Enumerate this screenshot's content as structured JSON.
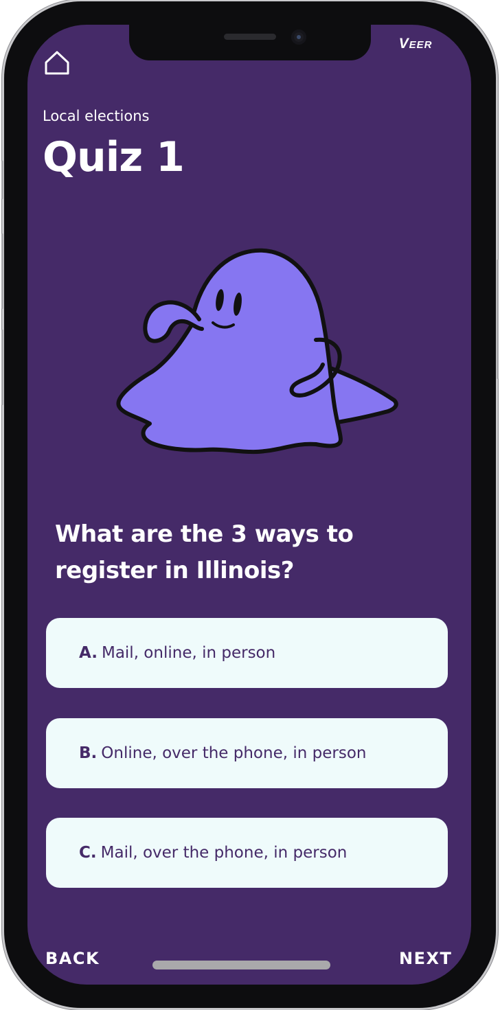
{
  "header": {
    "brand": "Veer",
    "home_icon": "home-icon"
  },
  "quiz": {
    "category": "Local elections",
    "title": "Quiz 1",
    "illustration": "ghost-mascot",
    "question": "What are the 3 ways to register in Illinois?",
    "options": [
      {
        "letter": "A.",
        "text": "Mail, online, in person"
      },
      {
        "letter": "B.",
        "text": "Online, over the phone, in person"
      },
      {
        "letter": "C.",
        "text": "Mail, over the phone, in person"
      }
    ]
  },
  "footer": {
    "back_label": "BACK",
    "next_label": "NEXT"
  },
  "colors": {
    "background": "#452a68",
    "option_bg": "#effbfb",
    "option_text": "#452a68",
    "mascot": "#8676f1"
  }
}
